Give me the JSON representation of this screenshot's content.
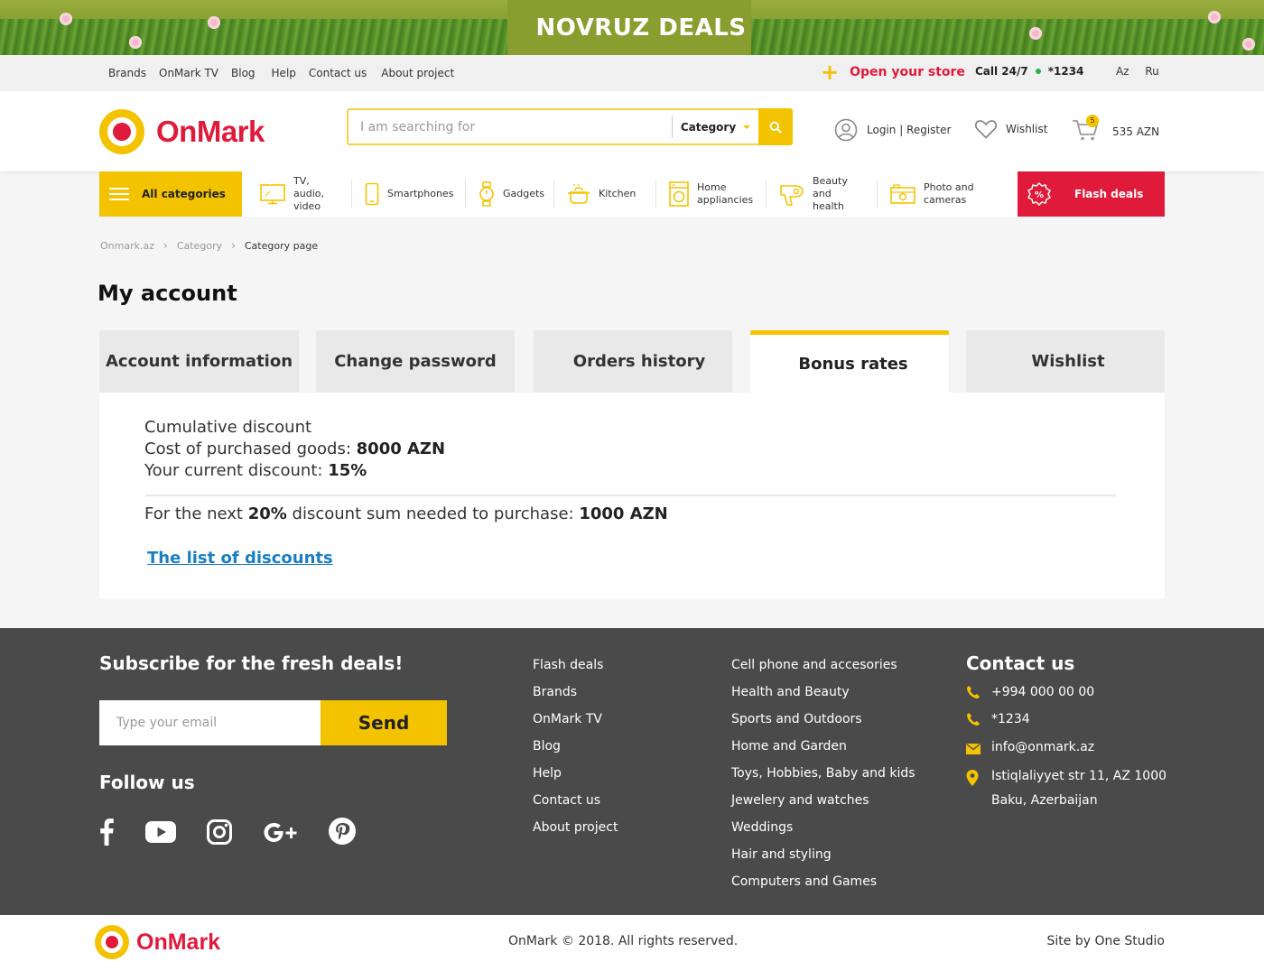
{
  "promo": {
    "title": "NOVRUZ DEALS"
  },
  "topbar": {
    "links": [
      "Brands",
      "OnMark TV",
      "Blog",
      "Help",
      "Contact us",
      "About project"
    ],
    "open_store": "Open your store",
    "call_label": "Call 24/7",
    "call_number": "*1234",
    "languages": [
      "Az",
      "Ru"
    ]
  },
  "header": {
    "logo_text": "OnMark",
    "search_placeholder": "I am searching for",
    "category_label": "Category",
    "login": "Login | Register",
    "wishlist": "Wishlist",
    "cart_count": "5",
    "cart_total": "535 AZN"
  },
  "catnav": {
    "all_categories": "All categories",
    "items": [
      {
        "label": "TV, audio, video",
        "icon": "tv-icon"
      },
      {
        "label": "Smartphones",
        "icon": "smartphone-icon"
      },
      {
        "label": "Gadgets",
        "icon": "watch-icon"
      },
      {
        "label": "Kitchen",
        "icon": "pot-icon"
      },
      {
        "label": "Home appliancies",
        "icon": "washing-machine-icon"
      },
      {
        "label": "Beauty and health",
        "icon": "hair-dryer-icon"
      },
      {
        "label": "Photo and cameras",
        "icon": "camera-icon"
      }
    ],
    "flash_deals": "Flash deals"
  },
  "breadcrumb": [
    "Onmark.az",
    "Category",
    "Category page"
  ],
  "page_title": "My account",
  "tabs": [
    {
      "label": "Account information",
      "active": false
    },
    {
      "label": "Change password",
      "active": false
    },
    {
      "label": "Orders history",
      "active": false
    },
    {
      "label": "Bonus rates",
      "active": true
    },
    {
      "label": "Wishlist",
      "active": false
    }
  ],
  "bonus": {
    "heading": "Cumulative discount",
    "cost_label": "Cost of purchased goods:",
    "cost_value": "8000 AZN",
    "current_label": "Your current discount:",
    "current_value": "15%",
    "next_prefix": "For the next",
    "next_percent": "20%",
    "next_middle": "discount sum needed to purchase:",
    "next_amount": "1000 AZN",
    "list_link": "The list of discounts"
  },
  "footer": {
    "subscribe_title": "Subscribe for the fresh deals!",
    "email_placeholder": "Type your email",
    "send": "Send",
    "follow_title": "Follow us",
    "col1": [
      "Flash deals",
      "Brands",
      "OnMark TV",
      "Blog",
      "Help",
      "Contact us",
      "About project"
    ],
    "col2": [
      "Cell phone and accesories",
      "Health and Beauty",
      "Sports and Outdoors",
      "Home and Garden",
      "Toys, Hobbies, Baby and kids",
      "Jewelery and watches",
      "Weddings",
      "Hair and styling",
      "Computers and Games"
    ],
    "contact_title": "Contact us",
    "phone": "+994 000 00 00",
    "short_phone": "*1234",
    "email": "info@onmark.az",
    "address1": "Istiqlaliyyet str 11, AZ 1000",
    "address2": "Baku, Azerbaijan"
  },
  "bottom": {
    "logo_text": "OnMark",
    "copyright": "OnMark © 2018. All rights reserved.",
    "credit": "Site by One Studio"
  },
  "colors": {
    "accent": "#f4c300",
    "brand": "#e01a3b",
    "link": "#1a7fc1",
    "footer": "#4a4a4a"
  }
}
